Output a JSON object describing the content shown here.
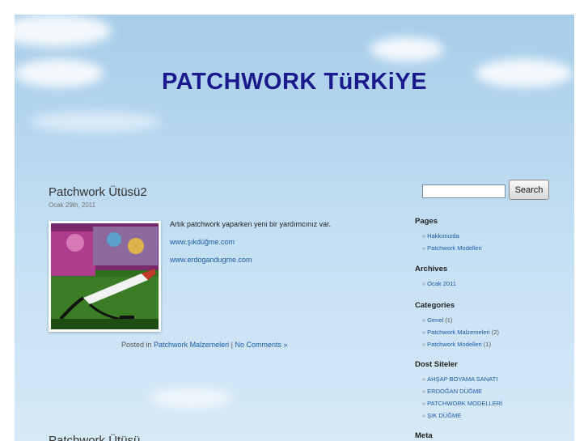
{
  "site": {
    "title": "PATCHWORK TüRKiYE"
  },
  "post1": {
    "title": "Patchwork Ütüsü2",
    "date": "Ocak 29th, 2011",
    "text": "Artık patchwork yaparken yeni bir yardımcınız var.",
    "link1": "www.şıkdüğme.com",
    "link2": "www.erdogandugme.com",
    "posted_in": "Posted in",
    "category": "Patchwork Malzemeleri",
    "separator": "|",
    "comments": "No Comments »"
  },
  "post2": {
    "title": "Patchwork Ütüsü"
  },
  "search": {
    "button": "Search",
    "value": ""
  },
  "sidebar": {
    "pages": {
      "heading": "Pages",
      "items": [
        "Hakkımızda",
        "Patchwork Modelleri"
      ]
    },
    "archives": {
      "heading": "Archives",
      "items": [
        "Ocak 2011"
      ]
    },
    "categories": {
      "heading": "Categories",
      "items": [
        {
          "label": "Genel",
          "count": "(1)"
        },
        {
          "label": "Patchwork Malzemeleri",
          "count": "(2)"
        },
        {
          "label": "Patchwork Modelleri",
          "count": "(1)"
        }
      ]
    },
    "dost": {
      "heading": "Dost Siteler",
      "items": [
        "AHŞAP BOYAMA SANATI",
        "ERDOĞAN DÜĞME",
        "PATCHWORK MODELLERİ",
        "ŞIK DÜĞME"
      ]
    },
    "meta": {
      "heading": "Meta"
    }
  },
  "bullet": "»",
  "colors": {
    "title": "#1a1a8c",
    "link": "#1a5aa8",
    "sky": "#b7d7ef"
  }
}
